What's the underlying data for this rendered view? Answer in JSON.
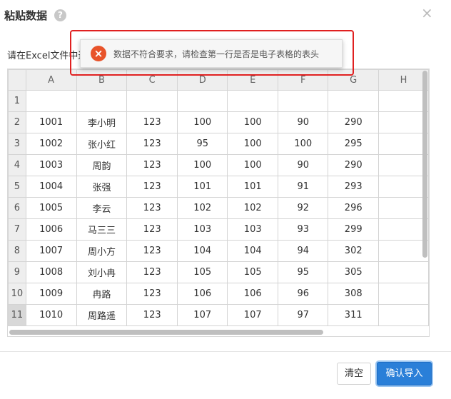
{
  "dialog": {
    "title": "粘贴数据",
    "help_icon": "?",
    "close_icon": "×",
    "instruction": "请在Excel文件中选"
  },
  "alert": {
    "message": "数据不符合要求，请检查第一行是否是电子表格的表头",
    "icon": "×",
    "color": "#e8532a"
  },
  "grid": {
    "columns": [
      "",
      "A",
      "B",
      "C",
      "D",
      "E",
      "F",
      "G",
      "H"
    ],
    "rows": [
      [
        "1",
        "",
        "",
        "",
        "",
        "",
        "",
        "",
        ""
      ],
      [
        "2",
        "1001",
        "李小明",
        "123",
        "100",
        "100",
        "90",
        "290",
        ""
      ],
      [
        "3",
        "1002",
        "张小红",
        "123",
        "95",
        "100",
        "100",
        "295",
        ""
      ],
      [
        "4",
        "1003",
        "周韵",
        "123",
        "100",
        "100",
        "90",
        "290",
        ""
      ],
      [
        "5",
        "1004",
        "张强",
        "123",
        "101",
        "101",
        "91",
        "293",
        ""
      ],
      [
        "6",
        "1005",
        "李云",
        "123",
        "102",
        "102",
        "92",
        "296",
        ""
      ],
      [
        "7",
        "1006",
        "马三三",
        "123",
        "103",
        "103",
        "93",
        "299",
        ""
      ],
      [
        "8",
        "1007",
        "周小方",
        "123",
        "104",
        "104",
        "94",
        "302",
        ""
      ],
      [
        "9",
        "1008",
        "刘小冉",
        "123",
        "105",
        "105",
        "95",
        "305",
        ""
      ],
      [
        "10",
        "1009",
        "冉路",
        "123",
        "106",
        "106",
        "96",
        "308",
        ""
      ],
      [
        "11",
        "1010",
        "周路遥",
        "123",
        "107",
        "107",
        "97",
        "311",
        ""
      ]
    ],
    "selected_row": "11"
  },
  "footer": {
    "clear_label": "清空",
    "import_label": "确认导入",
    "accent": "#2a7fd8"
  }
}
